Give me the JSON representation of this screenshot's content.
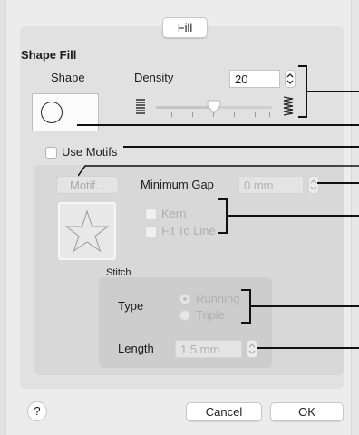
{
  "tab": {
    "label": "Fill"
  },
  "shape_fill": {
    "heading": "Shape Fill",
    "shape_label": "Shape",
    "density_label": "Density",
    "density_value": "20",
    "density_slider_fraction": 0.5
  },
  "use_motifs": {
    "label": "Use Motifs",
    "checked": false
  },
  "motif": {
    "button_label": "Motif...",
    "min_gap_label": "Minimum Gap",
    "min_gap_value": "0 mm",
    "kern_label": "Kern",
    "fit_to_line_label": "Fit To Line"
  },
  "stitch": {
    "heading": "Stitch",
    "type_label": "Type",
    "type_options": [
      "Running",
      "Triple"
    ],
    "type_selected": "Running",
    "length_label": "Length",
    "length_value": "1.5 mm"
  },
  "footer": {
    "help_label": "?",
    "cancel_label": "Cancel",
    "ok_label": "OK"
  }
}
